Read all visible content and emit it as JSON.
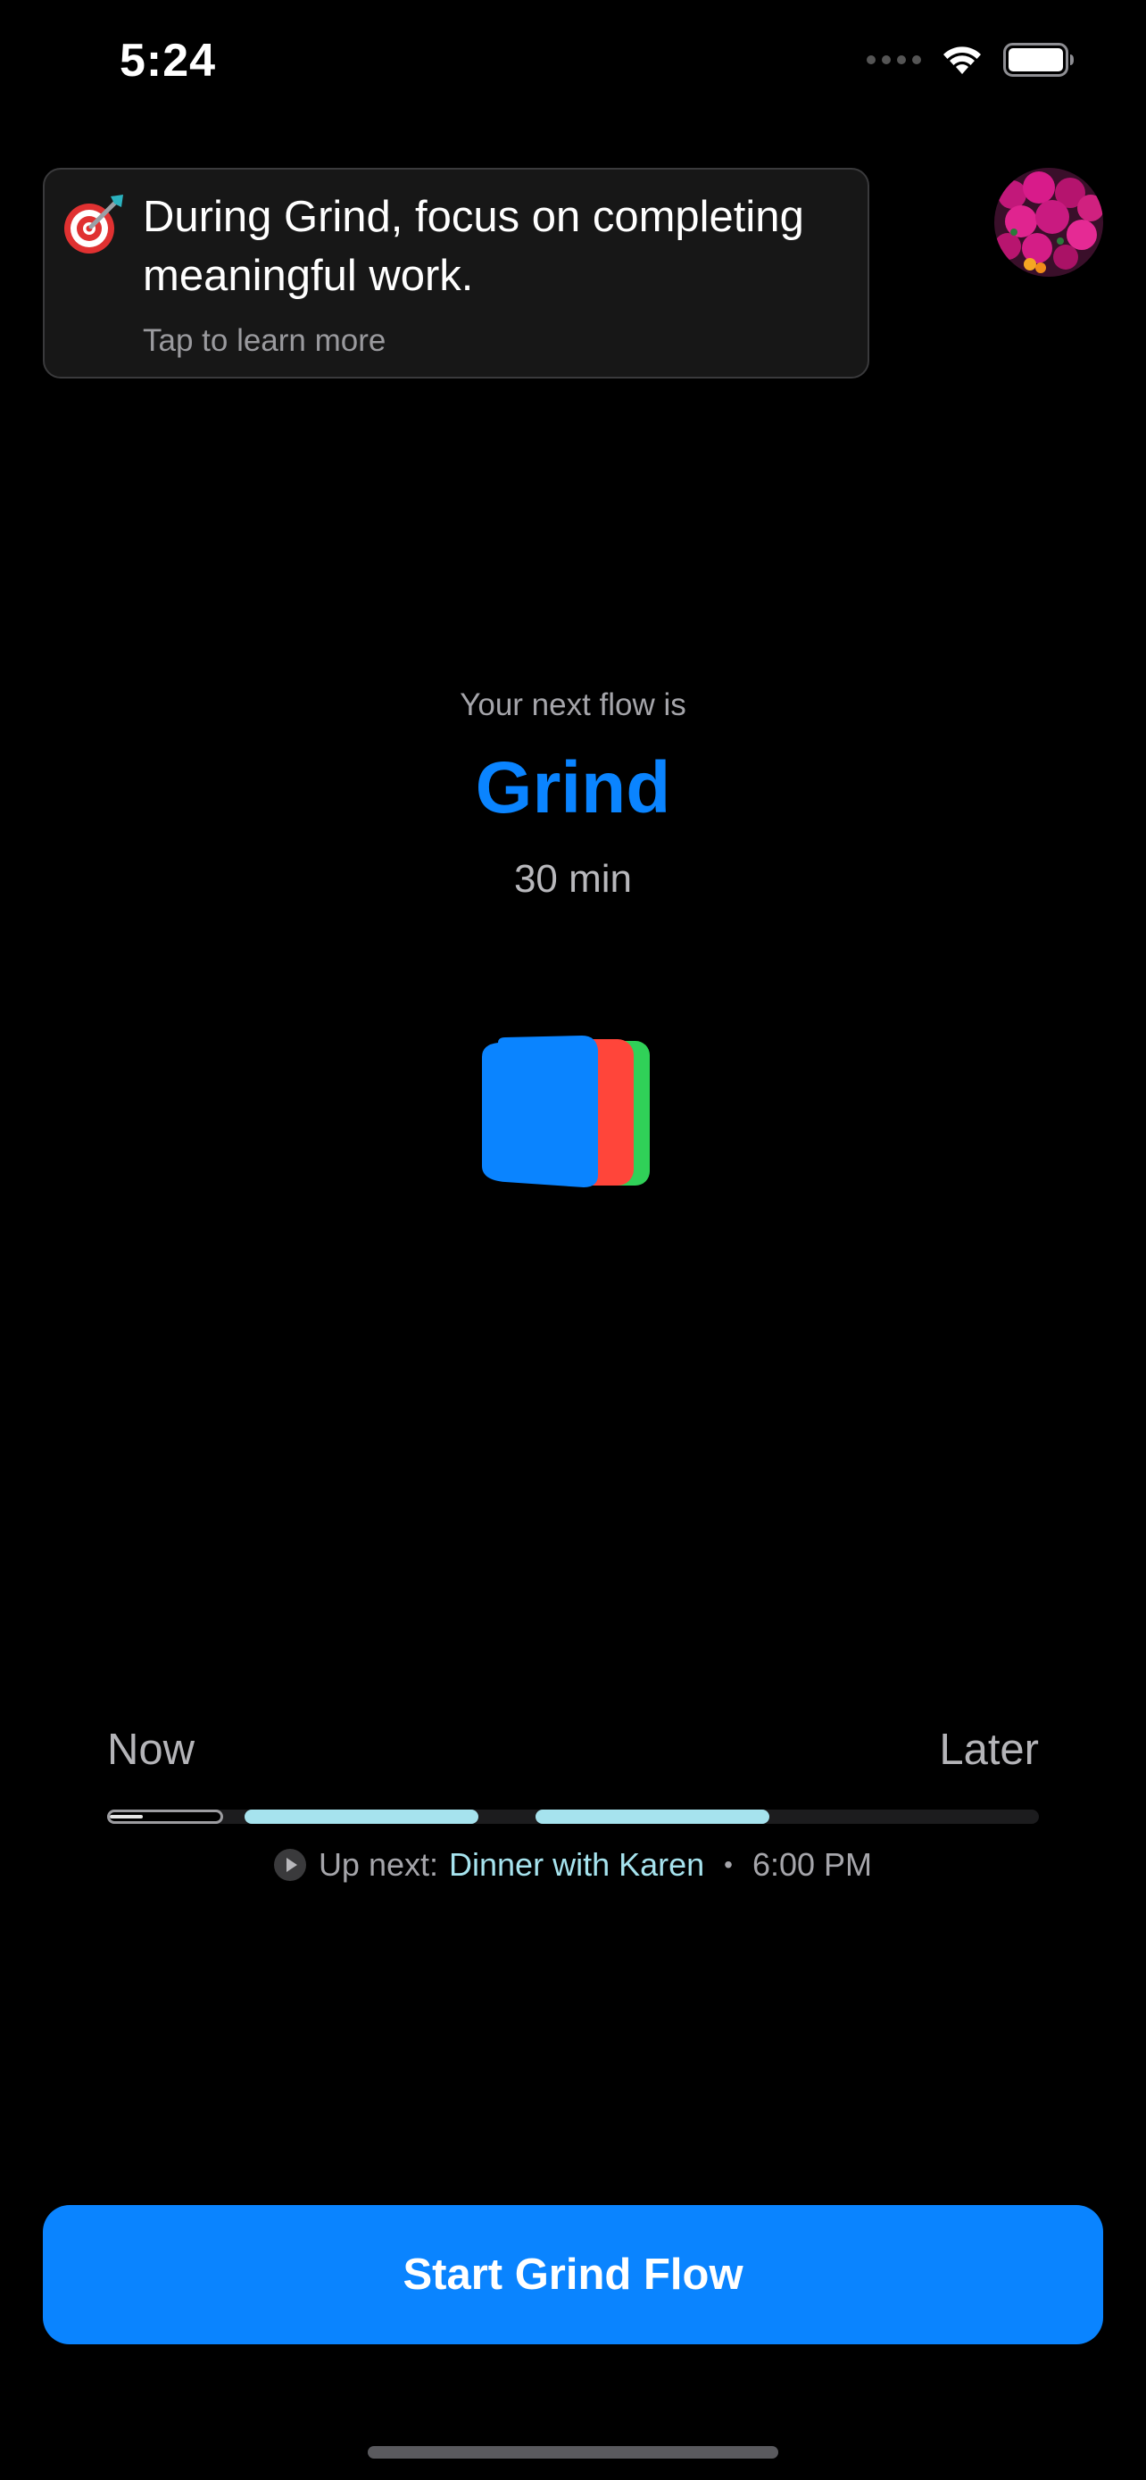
{
  "status_bar": {
    "time": "5:24",
    "icons": [
      "cellular-signal-icon",
      "wifi-icon",
      "battery-icon"
    ]
  },
  "tip": {
    "emoji_icon": "target-dart-icon",
    "text": "During Grind, focus on completing meaningful work.",
    "subtext": "Tap to learn more"
  },
  "avatar": {
    "icon": "avatar-flowers-photo"
  },
  "flow": {
    "label": "Your next flow is",
    "name": "Grind",
    "duration": "30 min",
    "logo_icon": "stacked-cards-logo"
  },
  "timeline": {
    "start_label": "Now",
    "end_label": "Later",
    "now_progress": 0.3,
    "up_next_prefix": "Up next:",
    "up_next_event": "Dinner with Karen",
    "separator": "•",
    "up_next_time": "6:00 PM"
  },
  "action": {
    "start_label": "Start Grind Flow"
  },
  "colors": {
    "accent": "#0a84ff",
    "event": "#a6e3ee",
    "card_red": "#ff453a",
    "card_green": "#30d158",
    "background": "#000000"
  }
}
